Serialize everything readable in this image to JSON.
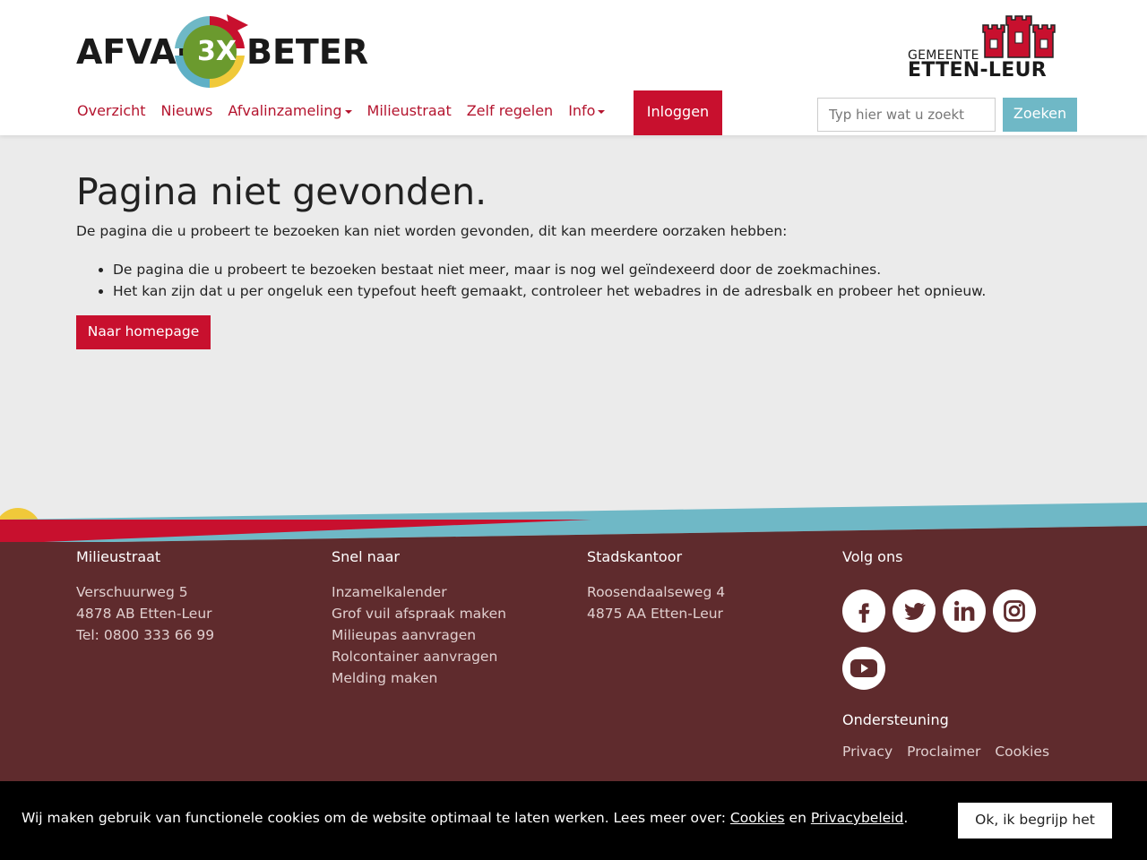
{
  "brand": {
    "word_left": "AFVAL",
    "word_center": "3X",
    "word_right": "BETER",
    "colors": {
      "red": "#c8102e",
      "green": "#6b9a2e",
      "blue": "#5fb0c6",
      "yellow": "#f0c93a"
    }
  },
  "municipality": {
    "line1": "GEMEENTE",
    "line2": "ETTEN-LEUR"
  },
  "nav": {
    "items": [
      {
        "label": "Overzicht",
        "dropdown": false
      },
      {
        "label": "Nieuws",
        "dropdown": false
      },
      {
        "label": "Afvalinzameling",
        "dropdown": true
      },
      {
        "label": "Milieustraat",
        "dropdown": false
      },
      {
        "label": "Zelf regelen",
        "dropdown": false
      },
      {
        "label": "Info",
        "dropdown": true
      }
    ],
    "login_label": "Inloggen"
  },
  "search": {
    "placeholder": "Typ hier wat u zoekt",
    "button_label": "Zoeken"
  },
  "main": {
    "title": "Pagina niet gevonden.",
    "intro": "De pagina die u probeert te bezoeken kan niet worden gevonden, dit kan meerdere oorzaken hebben:",
    "reasons": [
      "De pagina die u probeert te bezoeken bestaat niet meer, maar is nog wel geïndexeerd door de zoekmachines.",
      "Het kan zijn dat u per ongeluk een typefout heeft gemaakt, controleer het webadres in de adresbalk en probeer het opnieuw."
    ],
    "home_button": "Naar homepage"
  },
  "footer": {
    "milieustraat": {
      "title": "Milieustraat",
      "lines": [
        "Verschuurweg 5",
        "4878 AB Etten-Leur",
        "Tel: 0800 333 66 99"
      ]
    },
    "snel_naar": {
      "title": "Snel naar",
      "links": [
        "Inzamelkalender",
        "Grof vuil afspraak maken",
        "Milieupas aanvragen",
        "Rolcontainer aanvragen",
        "Melding maken"
      ]
    },
    "stadskantoor": {
      "title": "Stadskantoor",
      "lines": [
        "Roosendaalseweg 4",
        "4875 AA Etten-Leur"
      ]
    },
    "volg_ons": {
      "title": "Volg ons",
      "icons": [
        "facebook-icon",
        "twitter-icon",
        "linkedin-icon",
        "instagram-icon",
        "youtube-icon"
      ]
    },
    "ondersteuning": {
      "title": "Ondersteuning",
      "links": [
        "Privacy",
        "Proclaimer",
        "Cookies"
      ]
    },
    "colors": {
      "background": "#5f2b2d",
      "red_band": "#c8102e",
      "blue_band": "#6fb8c6"
    }
  },
  "cookie": {
    "text": "Wij maken gebruik van functionele cookies om de website optimaal te laten werken. Lees meer over: ",
    "link1": "Cookies",
    "between": " en ",
    "link2": "Privacybeleid",
    "end": ".",
    "button": "Ok, ik begrijp het"
  }
}
